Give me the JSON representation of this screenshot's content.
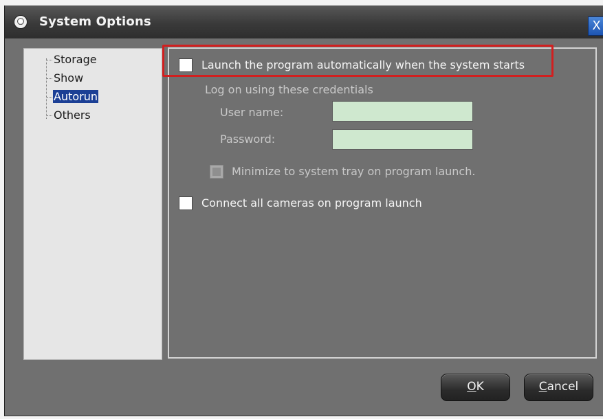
{
  "window": {
    "title": "System Options",
    "close_label": "X"
  },
  "tree": {
    "items": [
      {
        "label": "Storage",
        "selected": false
      },
      {
        "label": "Show",
        "selected": false
      },
      {
        "label": "Autorun",
        "selected": true
      },
      {
        "label": "Others",
        "selected": false
      }
    ]
  },
  "autorun": {
    "launch_label": "Launch the program automatically when the system starts",
    "launch_checked": false,
    "credentials_label": "Log on using these credentials",
    "username_label": "User name:",
    "username_value": "",
    "password_label": "Password:",
    "password_value": "",
    "minimize_label": "Minimize to system tray on program launch.",
    "minimize_enabled": false,
    "connect_label": "Connect all cameras on program launch",
    "connect_checked": false
  },
  "buttons": {
    "ok_first": "O",
    "ok_rest": "K",
    "cancel_first": "C",
    "cancel_rest": "ancel"
  },
  "colors": {
    "highlight": "#d21f1f",
    "selection": "#1b3f95",
    "field_bg": "#cfe8cf"
  }
}
